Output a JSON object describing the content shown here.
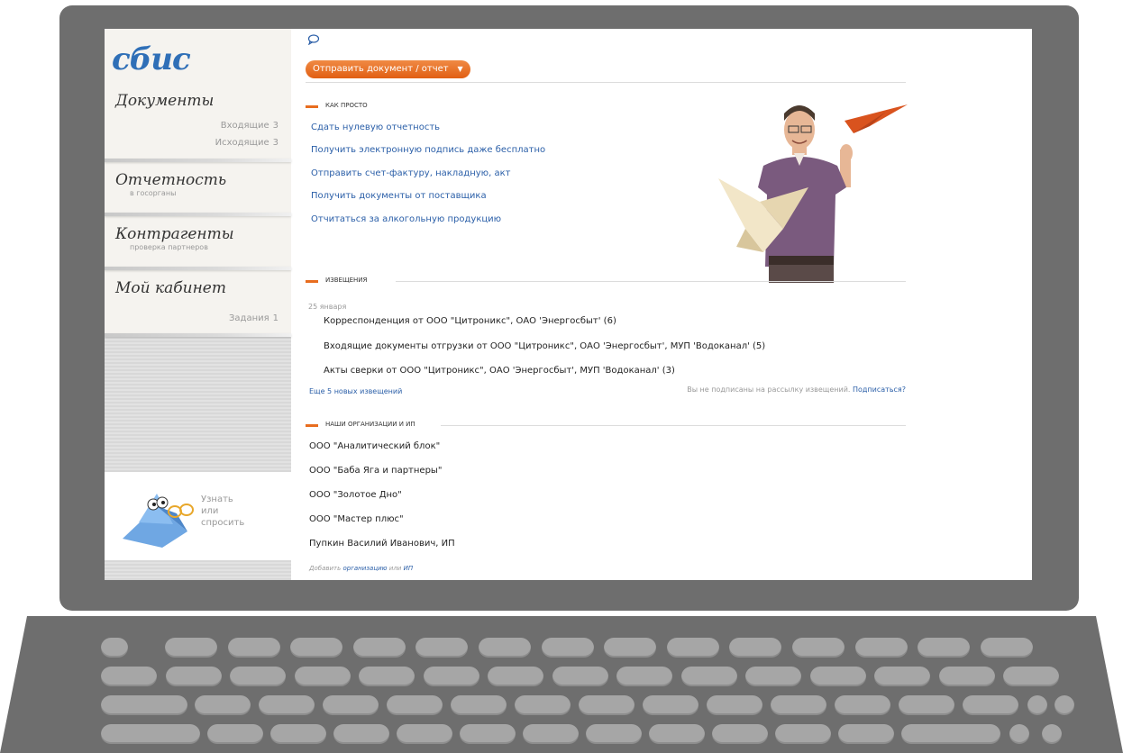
{
  "brand": {
    "logo_text": "сбис",
    "accent": "#2f6fb7",
    "orange": "#e86d1f"
  },
  "sidebar": {
    "sections": [
      {
        "title": "Документы",
        "links": [
          {
            "label": "Входящие",
            "count": "3"
          },
          {
            "label": "Исходящие",
            "count": "3"
          }
        ]
      },
      {
        "title": "Отчетность",
        "subtitle": "в госорганы"
      },
      {
        "title": "Контрагенты",
        "subtitle": "проверка партнеров"
      },
      {
        "title": "Мой кабинет",
        "links": [
          {
            "label": "Задания",
            "count": "1"
          }
        ]
      }
    ],
    "help": {
      "line1": "Узнать",
      "line2": "или",
      "line3": "спросить"
    }
  },
  "main": {
    "send_button": "Отправить документ / отчет",
    "how_simple": {
      "heading": "КАК ПРОСТО",
      "links": [
        "Сдать нулевую отчетность",
        "Получить электронную подпись даже бесплатно",
        "Отправить счет-фактуру, накладную, акт",
        "Получить документы от поставщика",
        "Отчитаться за алкогольную продукцию"
      ]
    },
    "notices": {
      "heading": "ИЗВЕЩЕНИЯ",
      "date": "25 января",
      "items": [
        "Корреспонденция от ООО \"Цитроникс\", ОАО 'Энергосбыт' (6)",
        "Входящие документы отгрузки от ООО \"Цитроникс\", ОАО 'Энергосбыт', МУП 'Водоканал' (5)",
        "Акты сверки от ООО \"Цитроникс\", ОАО 'Энергосбыт', МУП 'Водоканал' (3)"
      ],
      "more": "Еще 5 новых извещений",
      "subscribe_text": "Вы не подписаны на рассылку извещений.",
      "subscribe_link": "Подписаться?"
    },
    "orgs": {
      "heading": "НАШИ ОРГАНИЗАЦИИ И ИП",
      "items": [
        "ООО \"Аналитический блок\"",
        "ООО \"Баба Яга и партнеры\"",
        "ООО \"Золотое Дно\"",
        "ООО \"Мастер плюс\"",
        "Пупкин Василий Иванович, ИП"
      ],
      "add_prefix": "Добавить",
      "add_org": "организацию",
      "add_or": "или",
      "add_ip": "ИП"
    }
  }
}
